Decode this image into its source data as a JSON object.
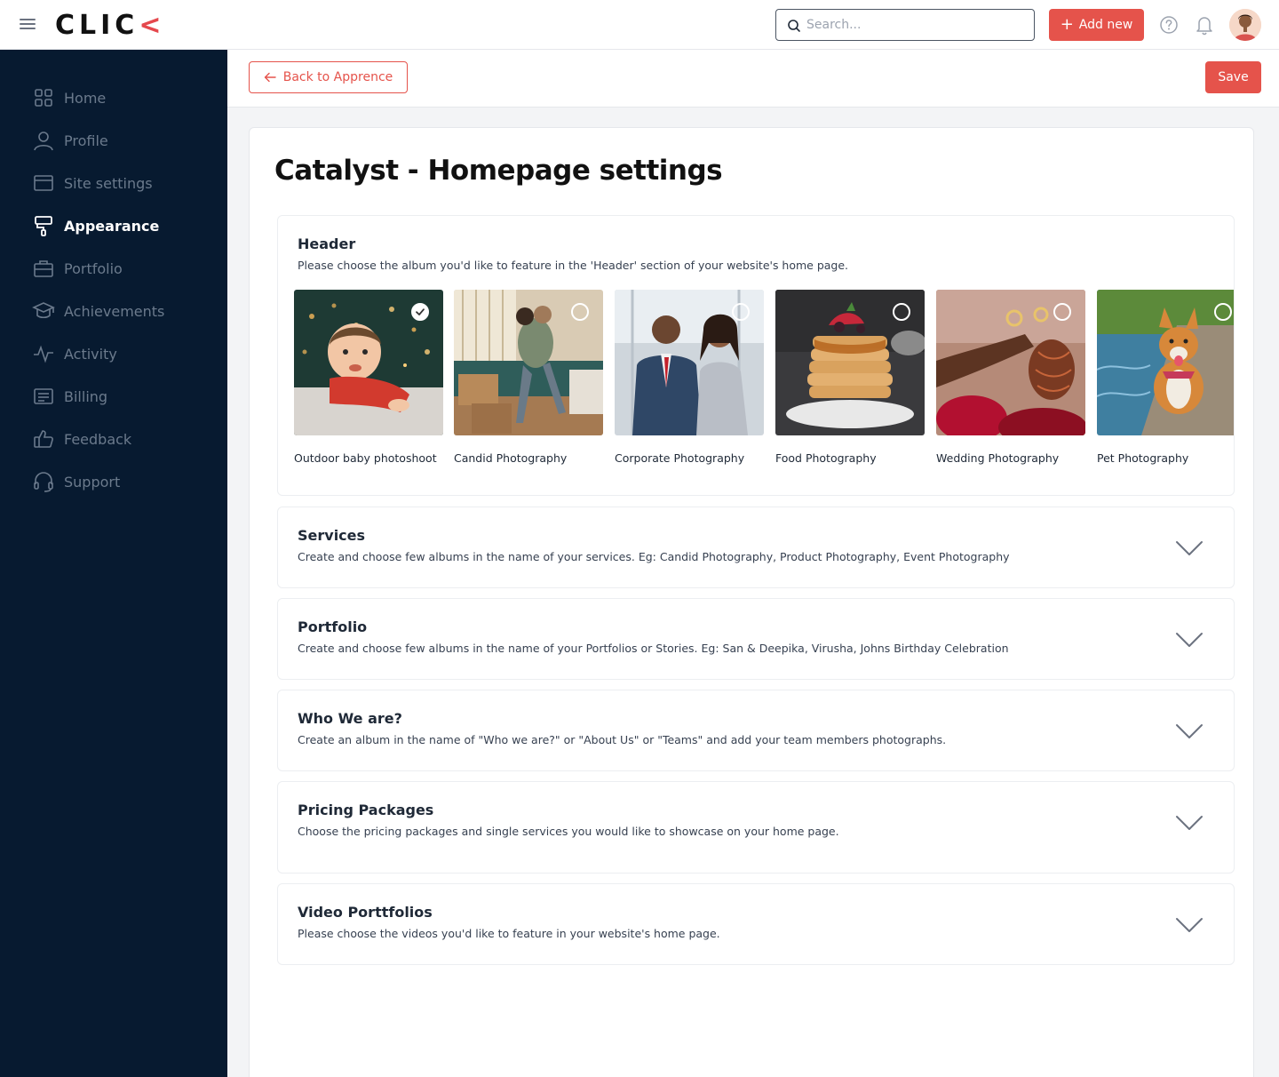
{
  "topbar": {
    "logo_main": "CLIC",
    "logo_accent": "<",
    "search_placeholder": "Search...",
    "add_new_label": "Add new"
  },
  "sidebar": {
    "items": [
      {
        "label": "Home",
        "icon": "grid-icon",
        "active": false
      },
      {
        "label": "Profile",
        "icon": "user-icon",
        "active": false
      },
      {
        "label": "Site settings",
        "icon": "browser-icon",
        "active": false
      },
      {
        "label": "Appearance",
        "icon": "paint-roller-icon",
        "active": true
      },
      {
        "label": "Portfolio",
        "icon": "briefcase-icon",
        "active": false
      },
      {
        "label": "Achievements",
        "icon": "graduation-cap-icon",
        "active": false
      },
      {
        "label": "Activity",
        "icon": "activity-icon",
        "active": false
      },
      {
        "label": "Billing",
        "icon": "receipt-icon",
        "active": false
      },
      {
        "label": "Feedback",
        "icon": "thumbs-up-icon",
        "active": false
      },
      {
        "label": "Support",
        "icon": "headset-icon",
        "active": false
      }
    ]
  },
  "subheader": {
    "back_label": "Back to Apprence",
    "save_label": "Save"
  },
  "page": {
    "title": "Catalyst - Homepage settings"
  },
  "sections": {
    "header": {
      "title": "Header",
      "desc": "Please choose the album you'd like to feature in the 'Header' section of your website's home page.",
      "albums": [
        {
          "caption": "Outdoor baby photoshoot",
          "selected": true
        },
        {
          "caption": "Candid Photography",
          "selected": false
        },
        {
          "caption": "Corporate Photography",
          "selected": false
        },
        {
          "caption": "Food Photography",
          "selected": false
        },
        {
          "caption": "Wedding Photography",
          "selected": false
        },
        {
          "caption": "Pet Photography",
          "selected": false
        }
      ]
    },
    "services": {
      "title": "Services",
      "desc": "Create and choose few albums in the name of your services. Eg: Candid Photography, Product Photography, Event Photography"
    },
    "portfolio": {
      "title": "Portfolio",
      "desc": "Create and choose few albums in the name of your Portfolios or Stories. Eg: San & Deepika, Virusha, Johns Birthday Celebration"
    },
    "who": {
      "title": "Who We are?",
      "desc": "Create an album in the name of \"Who we are?\" or \"About Us\" or \"Teams\" and add your team members photographs."
    },
    "pricing": {
      "title": "Pricing Packages",
      "desc": "Choose the pricing packages and single services you would like to showcase on your home page."
    },
    "video": {
      "title": "Video Porttfolios",
      "desc": "Please choose the videos you'd like to feature in your website's home page."
    }
  },
  "colors": {
    "accent": "#e5534b",
    "sidebar_bg": "#071a30",
    "sidebar_text": "#6b7a8c"
  }
}
